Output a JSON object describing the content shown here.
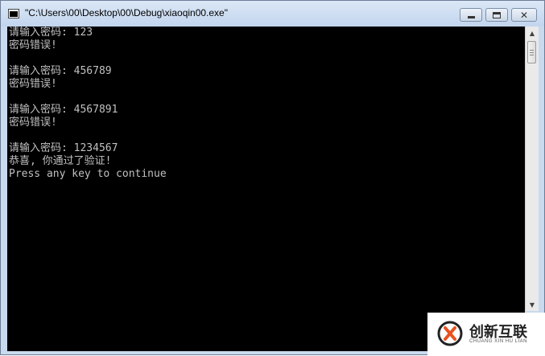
{
  "window": {
    "title": "\"C:\\Users\\00\\Desktop\\00\\Debug\\xiaoqin00.exe\""
  },
  "console": {
    "lines": [
      "请输入密码: 123",
      "密码错误!",
      "",
      "请输入密码: 456789",
      "密码错误!",
      "",
      "请输入密码: 4567891",
      "密码错误!",
      "",
      "请输入密码: 1234567",
      "恭喜, 你通过了验证!",
      "Press any key to continue"
    ]
  },
  "watermark": {
    "text": "创新互联",
    "subtext": "CHUANG XIN HU LIAN"
  },
  "colors": {
    "console_bg": "#000000",
    "console_text": "#c0c0c0",
    "titlebar": "#c9d9ee"
  },
  "icons": [
    "console-app-icon",
    "minimize-icon",
    "maximize-icon",
    "close-icon",
    "scroll-up-icon",
    "scroll-down-icon",
    "logo-icon"
  ]
}
